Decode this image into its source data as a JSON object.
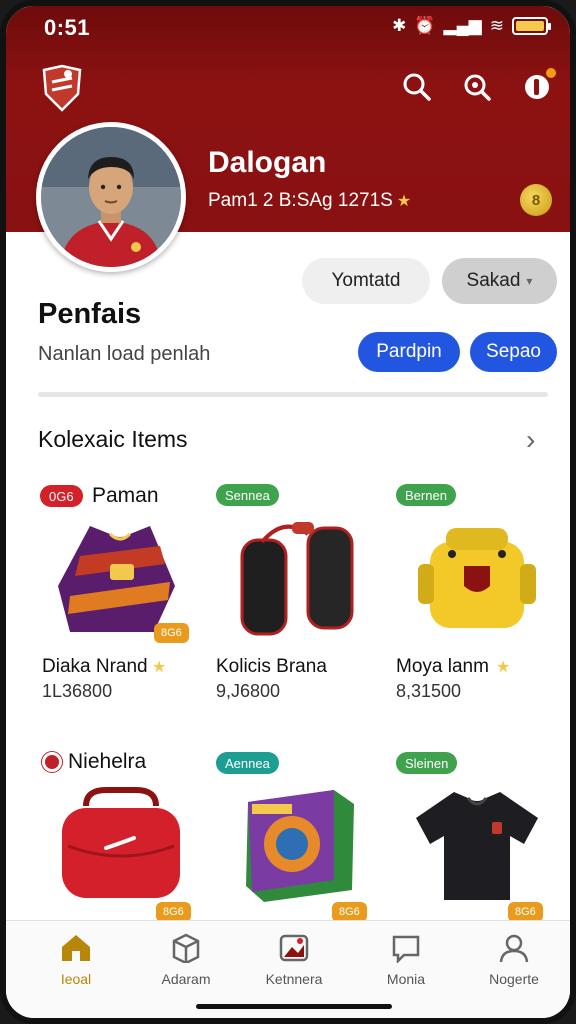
{
  "status": {
    "time": "0:51"
  },
  "header": {
    "profile_name": "Dalogan",
    "profile_sub": "Pam1 2 B:SAg 1271S",
    "coin_label": "8"
  },
  "actions": {
    "follow_label": "Yomtatd",
    "select_label": "Sakad"
  },
  "profile": {
    "title": "Penfais",
    "subtitle": "Nanlan load penlah",
    "btn1": "Pardpin",
    "btn2": "Sepao"
  },
  "collection": {
    "title": "Kolexaic Items",
    "row_top_label": "Paman",
    "row_top_badge": "0G6",
    "row2_label": "Niehelra",
    "items": [
      {
        "tag": "",
        "name": "Diaka Nrand",
        "price": "1L36800",
        "corner": "8G6"
      },
      {
        "tag": "Sennea",
        "name": "Kolicis Brana",
        "price": "9,J6800",
        "corner": ""
      },
      {
        "tag": "Bernen",
        "name": "Moya lanm",
        "price": "8,31500",
        "corner": ""
      },
      {
        "tag": "",
        "name": "",
        "price": "",
        "corner": "8G6"
      },
      {
        "tag": "Aennea",
        "name": "",
        "price": "",
        "corner": "8G6"
      },
      {
        "tag": "Sleinen",
        "name": "",
        "price": "",
        "corner": "8G6"
      }
    ]
  },
  "nav": [
    {
      "label": "Ieoal",
      "active": true
    },
    {
      "label": "Adaram",
      "active": false
    },
    {
      "label": "Ketnnera",
      "active": false
    },
    {
      "label": "Monia",
      "active": false
    },
    {
      "label": "Nogerte",
      "active": false
    }
  ],
  "colors": {
    "brand": "#8c1212",
    "accent": "#2356e0",
    "active_nav": "#b8860b"
  }
}
